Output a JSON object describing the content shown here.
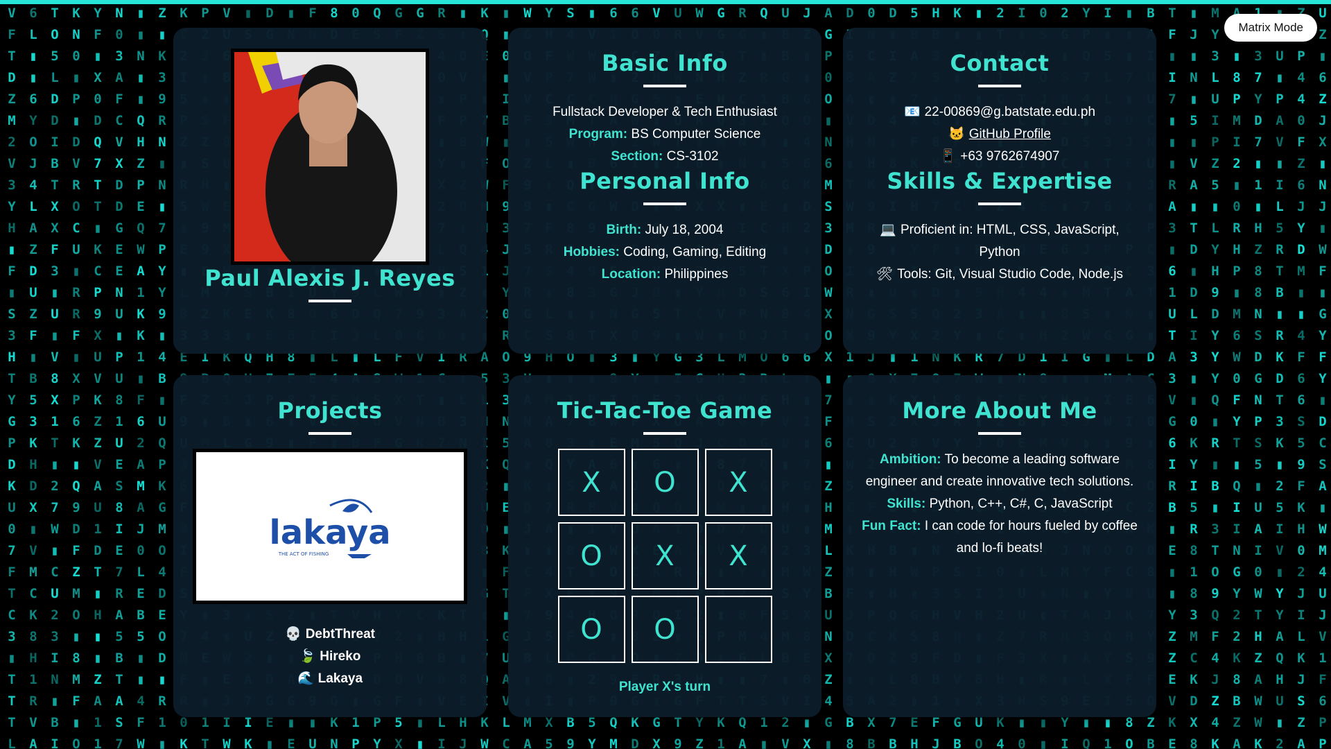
{
  "toolbar": {
    "matrix_mode_label": "Matrix Mode"
  },
  "profile": {
    "name": "Paul Alexis J. Reyes"
  },
  "basic_info": {
    "title": "Basic Info",
    "tagline": "Fullstack Developer & Tech Enthusiast",
    "program_label": "Program:",
    "program_value": "BS Computer Science",
    "section_label": "Section:",
    "section_value": "CS-3102"
  },
  "personal_info": {
    "title": "Personal Info",
    "birth_label": "Birth:",
    "birth_value": "July 18, 2004",
    "hobbies_label": "Hobbies:",
    "hobbies_value": "Coding, Gaming, Editing",
    "location_label": "Location:",
    "location_value": "Philippines"
  },
  "contact": {
    "title": "Contact",
    "email_icon": "📧",
    "email": "22-00869@g.batstate.edu.ph",
    "github_icon": "🐱",
    "github_label": "GitHub Profile",
    "phone_icon": "📱",
    "phone": "+63 9762674907"
  },
  "skills": {
    "title": "Skills & Expertise",
    "proficient_icon": "💻",
    "proficient": "Proficient in: HTML, CSS, JavaScript, Python",
    "tools_icon": "🛠",
    "tools": "Tools: Git, Visual Studio Code, Node.js"
  },
  "projects": {
    "title": "Projects",
    "logo_text": "lakaya",
    "logo_tagline": "THE ACT OF FISHING",
    "items": [
      {
        "icon": "💀",
        "label": "DebtThreat"
      },
      {
        "icon": "🍃",
        "label": "Hireko"
      },
      {
        "icon": "🌊",
        "label": "Lakaya"
      }
    ]
  },
  "tictactoe": {
    "title": "Tic-Tac-Toe Game",
    "cells": [
      "X",
      "O",
      "X",
      "O",
      "X",
      "X",
      "O",
      "O",
      ""
    ],
    "status": "Player X's turn"
  },
  "more_about": {
    "title": "More About Me",
    "ambition_label": "Ambition:",
    "ambition_value": "To become a leading software engineer and create innovative tech solutions.",
    "skills_label": "Skills:",
    "skills_value": "Python, C++, C#, C, JavaScript",
    "funfact_label": "Fun Fact:",
    "funfact_value": "I can code for hours fueled by coffee and lo-fi beats!"
  },
  "colors": {
    "accent": "#3fe3cf",
    "card_bg": "#0d1c2a",
    "matrix": "#17e0d6"
  }
}
